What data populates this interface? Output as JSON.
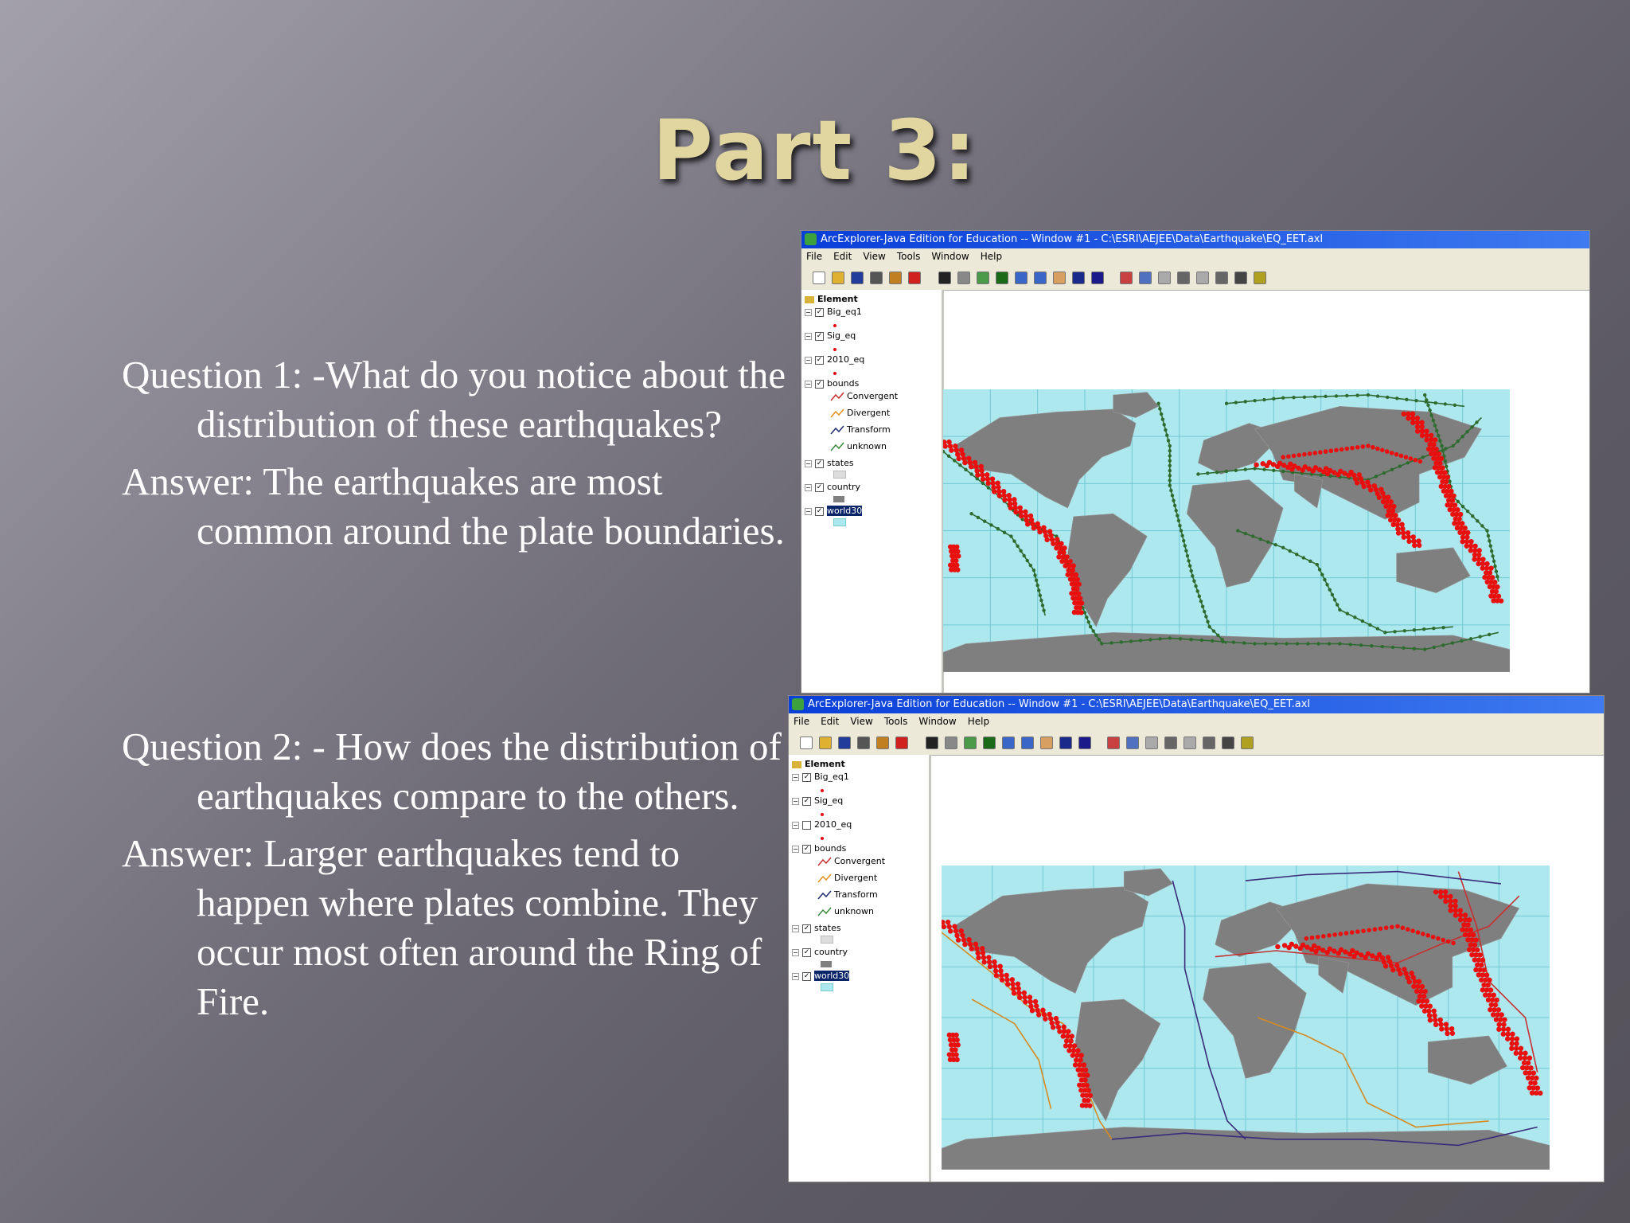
{
  "slide": {
    "title": "Part 3:",
    "items": [
      {
        "label": "Question 1:",
        "text": " -What do you notice about the distribution of these earthquakes?"
      },
      {
        "label": "Answer:",
        "text": "  The earthquakes are most common around the plate boundaries."
      },
      {
        "label": "Question 2:",
        "text": " - How does the distribution of earthquakes compare to the others."
      },
      {
        "label": "Answer:",
        "text": "  Larger earthquakes tend to happen where plates combine. They occur most often around the Ring of Fire."
      }
    ]
  },
  "window": {
    "title": "ArcExplorer-Java Edition for Education  --  Window #1 - C:\\ESRI\\AEJEE\\Data\\Earthquake\\EQ_EET.axl",
    "menu": [
      "File",
      "Edit",
      "View",
      "Tools",
      "Window",
      "Help"
    ],
    "layers": {
      "root": "Element",
      "items": [
        {
          "name": "Big_eq1",
          "checked": true
        },
        {
          "name": "Sig_eq",
          "checked": true
        },
        {
          "name": "2010_eq",
          "checked": true
        },
        {
          "name": "bounds",
          "checked": true
        },
        {
          "name": "Convergent",
          "legend": true
        },
        {
          "name": "Divergent",
          "legend": true
        },
        {
          "name": "Transform",
          "legend": true
        },
        {
          "name": "unknown",
          "legend": true
        },
        {
          "name": "states",
          "checked": true
        },
        {
          "name": "country",
          "checked": true
        },
        {
          "name": "world30",
          "checked": true,
          "selected": true
        }
      ]
    },
    "second_window_2010_eq_checked": false
  },
  "colors": {
    "earthquake": "#e80f0f",
    "small_quake": "#2e6b2e",
    "ocean": "#aee8ef",
    "land": "#7f7f7f",
    "title_text": "#e2d6a0"
  }
}
